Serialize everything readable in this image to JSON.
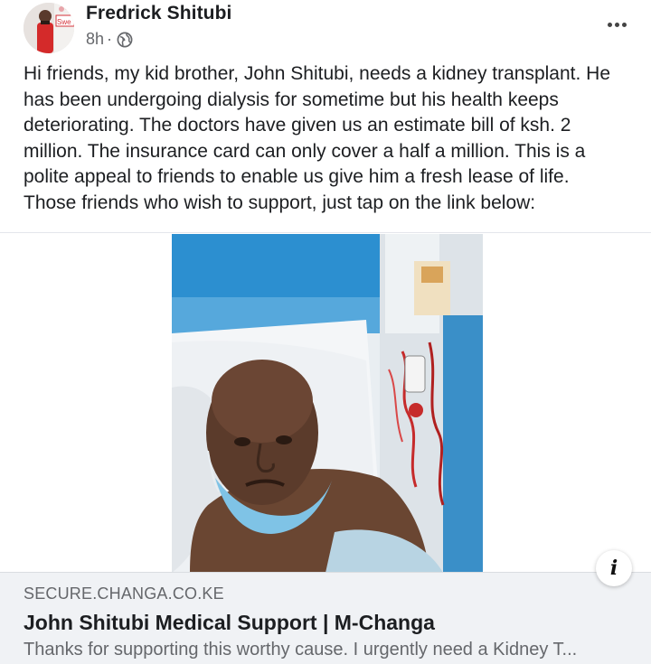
{
  "post": {
    "author": "Fredrick Shitubi",
    "time": "8h",
    "separator": "·",
    "privacy_icon": "globe-icon",
    "more_icon": "more-horizontal-icon",
    "text": "Hi friends, my kid brother, John Shitubi, needs a kidney transplant. He\nhas been undergoing dialysis for sometime but his health keeps\ndeteriorating. The doctors have given us an estimate bill of ksh. 2\nmillion. The insurance card can only cover a half a million. This is a\npolite appeal to friends to enable us give him a fresh lease of life.\nThose friends who wish to support, just tap on the link below:"
  },
  "avatar": {
    "badge_text": "Swe"
  },
  "media": {
    "info_icon_glyph": "i"
  },
  "link_preview": {
    "domain": "SECURE.CHANGA.CO.KE",
    "title": "John Shitubi Medical Support | M-Changa",
    "description": "Thanks for supporting this worthy cause. I urgently need a Kidney T..."
  },
  "colors": {
    "primary_text": "#1c1e21",
    "secondary_text": "#65676b",
    "preview_bg": "#f0f2f5"
  }
}
